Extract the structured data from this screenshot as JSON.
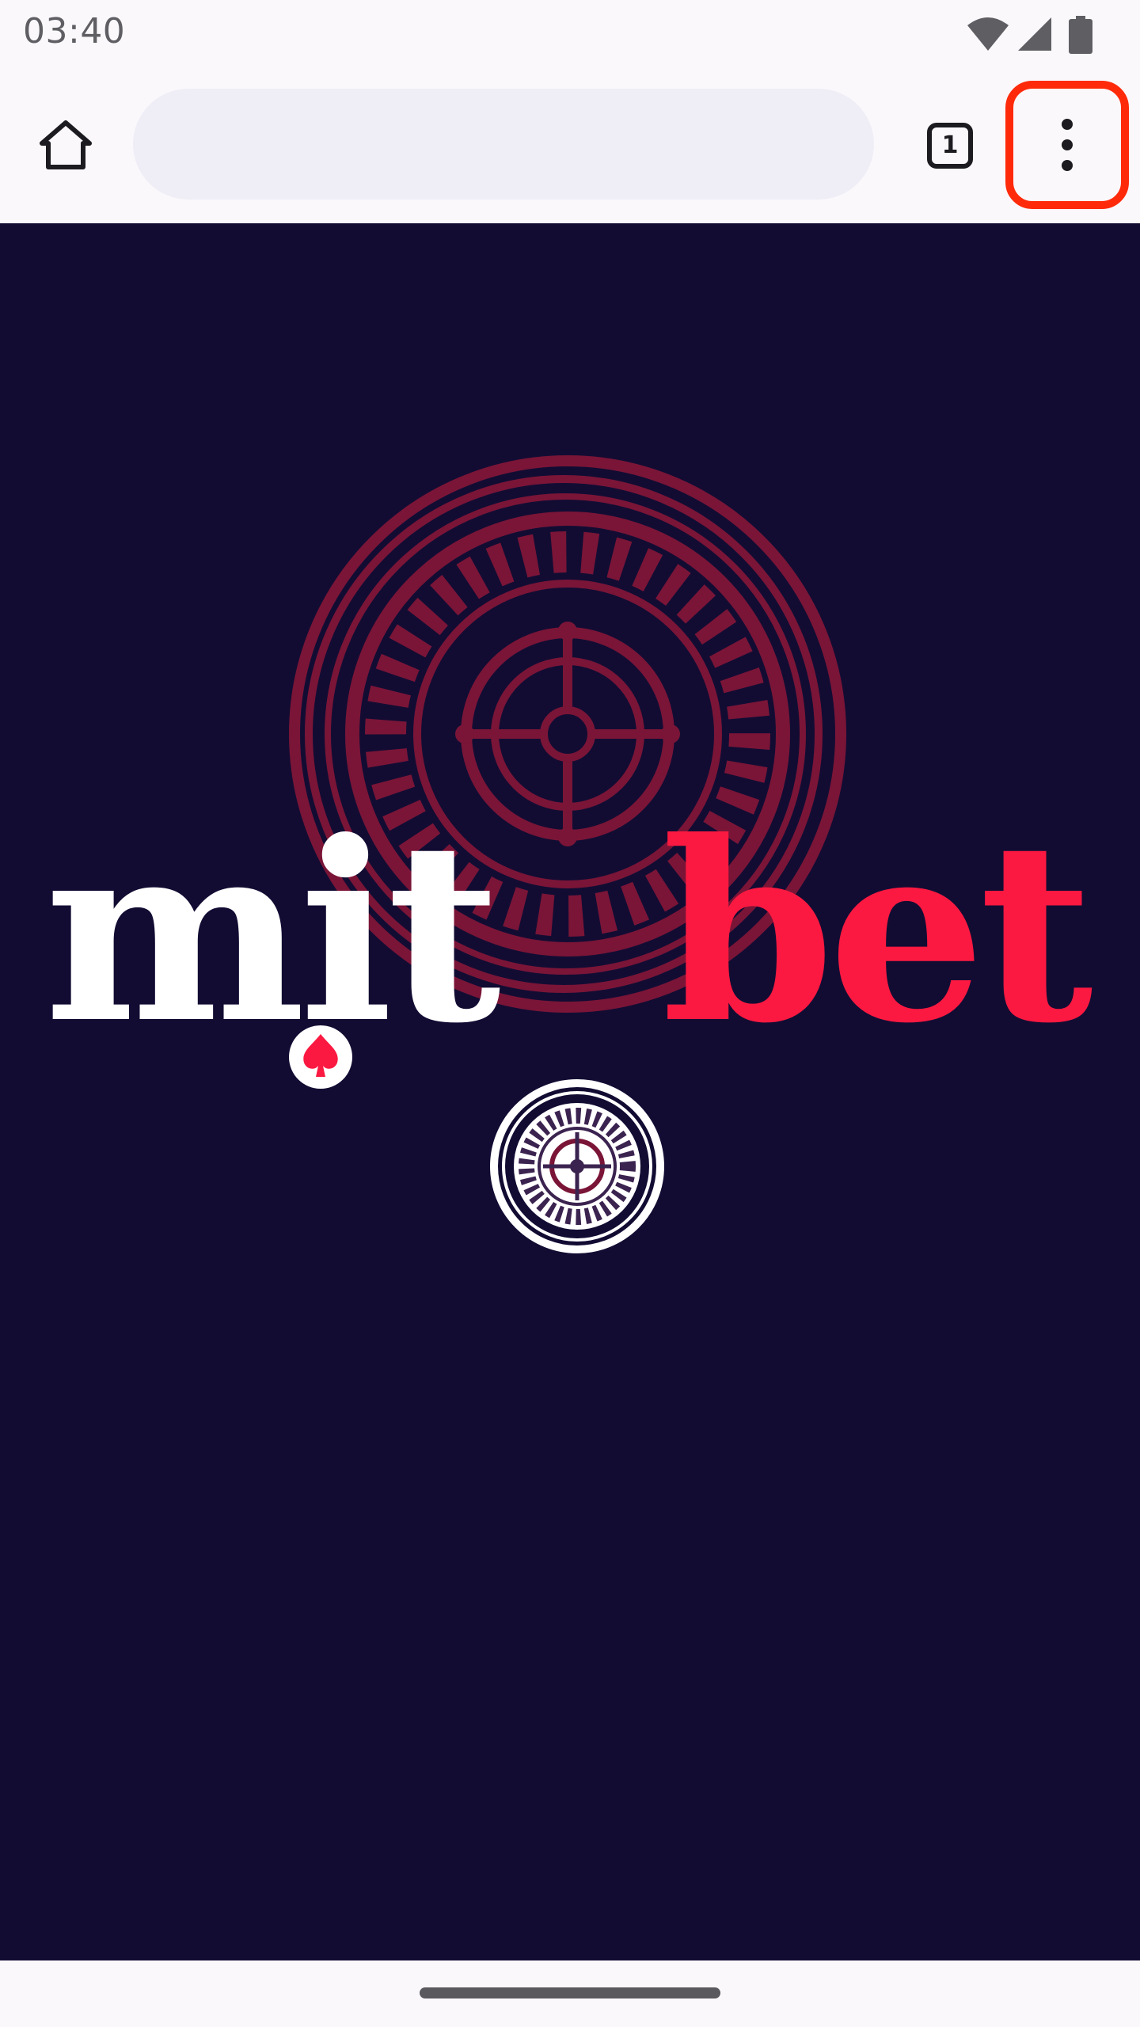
{
  "status_bar": {
    "time": "03:40",
    "icons": [
      "wifi-icon",
      "cellular-signal-icon",
      "battery-icon"
    ]
  },
  "toolbar": {
    "home_icon": "home-icon",
    "url_value": "",
    "url_placeholder": "",
    "tab_count": "1",
    "menu_icon": "more-vertical-icon"
  },
  "page": {
    "logo_part_1": "mit",
    "logo_part_2": "bet",
    "logo_alt": "mitobet",
    "colors": {
      "background": "#120c33",
      "accent": "#fb1941",
      "roulette_watermark": "#7a1537",
      "logo_white": "#ffffff"
    },
    "icons": [
      "roulette-wheel-icon",
      "spade-icon"
    ]
  },
  "colors": {
    "highlight_box": "#ff2a0a",
    "system_bar": "#fbf8fc",
    "url_bar": "#efeef6"
  }
}
